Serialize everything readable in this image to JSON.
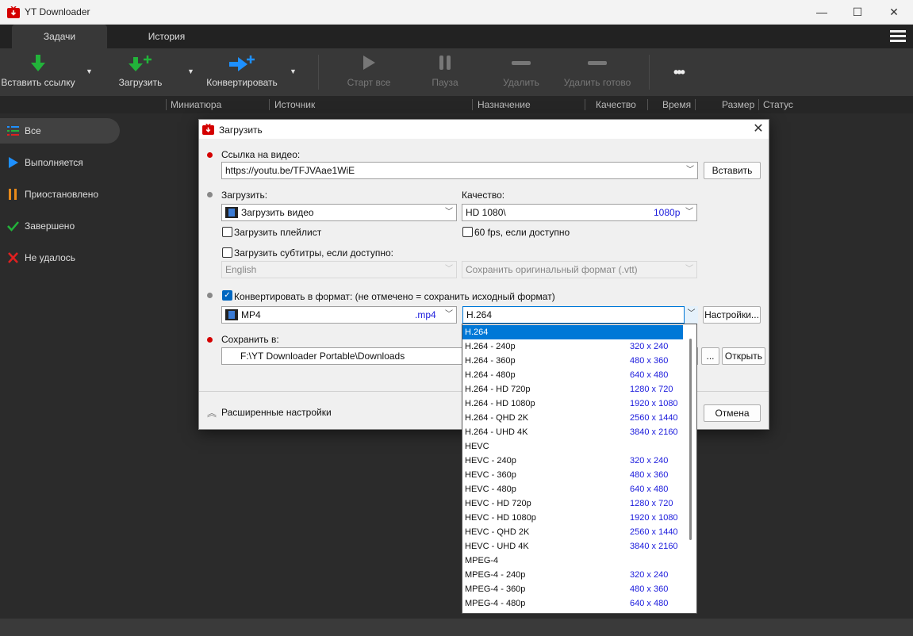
{
  "window": {
    "title": "YT Downloader",
    "minimize": "—",
    "maximize": "☐",
    "close": "✕"
  },
  "tabs": {
    "tasks": "Задачи",
    "history": "История"
  },
  "toolbar": {
    "paste": "Вставить ссылку",
    "download": "Загрузить",
    "convert": "Конвертировать",
    "start_all": "Старт все",
    "pause": "Пауза",
    "delete": "Удалить",
    "delete_done": "Удалить готово",
    "more": "•••"
  },
  "columns": [
    "Миниатюра",
    "Источник",
    "Назначение",
    "Качество",
    "Время",
    "Размер",
    "Статус"
  ],
  "sidebar": [
    {
      "label": "Все"
    },
    {
      "label": "Выполняется"
    },
    {
      "label": "Приостановлено"
    },
    {
      "label": "Завершено"
    },
    {
      "label": "Не удалось"
    }
  ],
  "dialog": {
    "title": "Загрузить",
    "url_label": "Ссылка на видео:",
    "url_value": "https://youtu.be/TFJVAae1WiE",
    "paste_btn": "Вставить",
    "download_label": "Загрузить:",
    "download_value": "Загрузить видео",
    "quality_label": "Качество:",
    "quality_value": "HD 1080\\",
    "quality_res": "1080p",
    "playlist_label": "Загрузить плейлист",
    "fps_label": "60 fps, если доступно",
    "subs_label": "Загрузить субтитры, если доступно:",
    "subs_lang": "English",
    "subs_format": "Сохранить оригинальный формат (.vtt)",
    "convert_label": "Конвертировать в формат: (не отмечено = сохранить исходный формат)",
    "format_value": "MP4",
    "format_ext": ".mp4",
    "codec_value": "H.264",
    "settings_btn": "Настройки...",
    "save_label": "Сохранить в:",
    "save_path": "F:\\YT Downloader Portable\\Downloads",
    "browse_btn": "...",
    "open_btn": "Открыть",
    "advanced_label": "Расширенные настройки",
    "cancel_btn": "Отмена"
  },
  "codec_list": [
    {
      "name": "H.264",
      "res": ""
    },
    {
      "name": "H.264 - 240p",
      "res": "320 x 240"
    },
    {
      "name": "H.264 - 360p",
      "res": "480 x 360"
    },
    {
      "name": "H.264 - 480p",
      "res": "640 x 480"
    },
    {
      "name": "H.264 - HD 720p",
      "res": "1280 x 720"
    },
    {
      "name": "H.264 - HD 1080p",
      "res": "1920 x 1080"
    },
    {
      "name": "H.264 - QHD 2K",
      "res": "2560 x 1440"
    },
    {
      "name": "H.264 - UHD 4K",
      "res": "3840 x 2160"
    },
    {
      "name": "HEVC",
      "res": ""
    },
    {
      "name": "HEVC - 240p",
      "res": "320 x 240"
    },
    {
      "name": "HEVC - 360p",
      "res": "480 x 360"
    },
    {
      "name": "HEVC - 480p",
      "res": "640 x 480"
    },
    {
      "name": "HEVC - HD 720p",
      "res": "1280 x 720"
    },
    {
      "name": "HEVC - HD 1080p",
      "res": "1920 x 1080"
    },
    {
      "name": "HEVC - QHD 2K",
      "res": "2560 x 1440"
    },
    {
      "name": "HEVC - UHD 4K",
      "res": "3840 x 2160"
    },
    {
      "name": "MPEG-4",
      "res": ""
    },
    {
      "name": "MPEG-4 - 240p",
      "res": "320 x 240"
    },
    {
      "name": "MPEG-4 - 360p",
      "res": "480 x 360"
    },
    {
      "name": "MPEG-4 - 480p",
      "res": "640 x 480"
    }
  ],
  "selected_codec_index": 0,
  "colors": {
    "accent": "#0078d7",
    "green": "#22b33a",
    "blue": "#1e90ff",
    "orange": "#e88a1a",
    "red": "#e02020"
  }
}
